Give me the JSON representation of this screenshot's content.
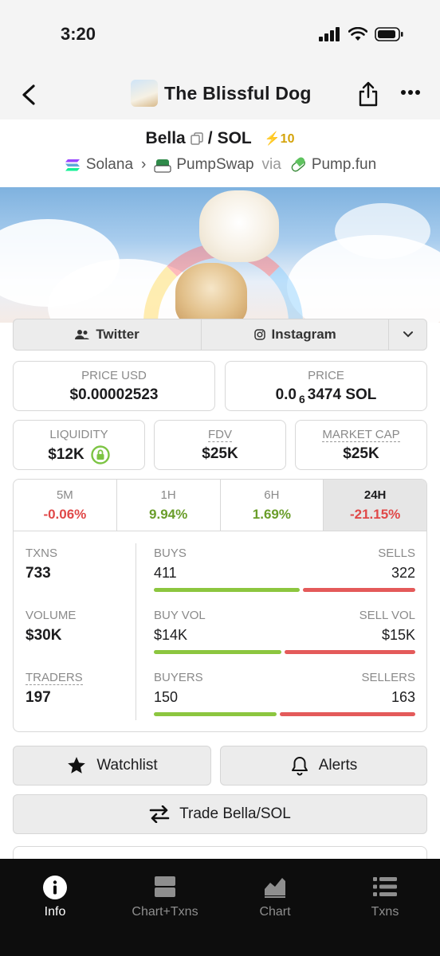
{
  "status_bar": {
    "time": "3:20"
  },
  "nav": {
    "title": "The Blissful Dog"
  },
  "pair": {
    "base": "Bella",
    "separator": "/",
    "quote": "SOL",
    "boost": "⚡10",
    "chain": "Solana",
    "dex": "PumpSwap",
    "via": "via",
    "launchpad": "Pump.fun"
  },
  "socials": {
    "twitter": "Twitter",
    "instagram": "Instagram"
  },
  "price_usd": {
    "label": "PRICE USD",
    "value": "$0.00002523"
  },
  "price_native": {
    "label": "PRICE",
    "prefix": "0.0",
    "sub": "6",
    "suffix": "3474 SOL"
  },
  "liquidity": {
    "label": "LIQUIDITY",
    "value": "$12K"
  },
  "fdv": {
    "label": "FDV",
    "value": "$25K"
  },
  "market_cap": {
    "label": "MARKET CAP",
    "value": "$25K"
  },
  "timeframes": [
    {
      "label": "5M",
      "value": "-0.06%"
    },
    {
      "label": "1H",
      "value": "9.94%"
    },
    {
      "label": "6H",
      "value": "1.69%"
    },
    {
      "label": "24H",
      "value": "-21.15%"
    }
  ],
  "txns": {
    "label": "TXNS",
    "value": "733",
    "left_label": "BUYS",
    "left_value": "411",
    "right_label": "SELLS",
    "right_value": "322"
  },
  "volume": {
    "label": "VOLUME",
    "value": "$30K",
    "left_label": "BUY VOL",
    "left_value": "$14K",
    "right_label": "SELL VOL",
    "right_value": "$15K"
  },
  "traders": {
    "label": "TRADERS",
    "value": "197",
    "left_label": "BUYERS",
    "left_value": "150",
    "right_label": "SELLERS",
    "right_value": "163"
  },
  "actions": {
    "watchlist": "Watchlist",
    "alerts": "Alerts",
    "trade": "Trade Bella/SOL"
  },
  "tab_bar": [
    {
      "label": "Info"
    },
    {
      "label": "Chart+Txns"
    },
    {
      "label": "Chart"
    },
    {
      "label": "Txns"
    }
  ],
  "colors": {
    "positive": "#6a9d2a",
    "negative": "#e04848",
    "buy_bar": "#8cc63f",
    "sell_bar": "#e45a5a"
  }
}
